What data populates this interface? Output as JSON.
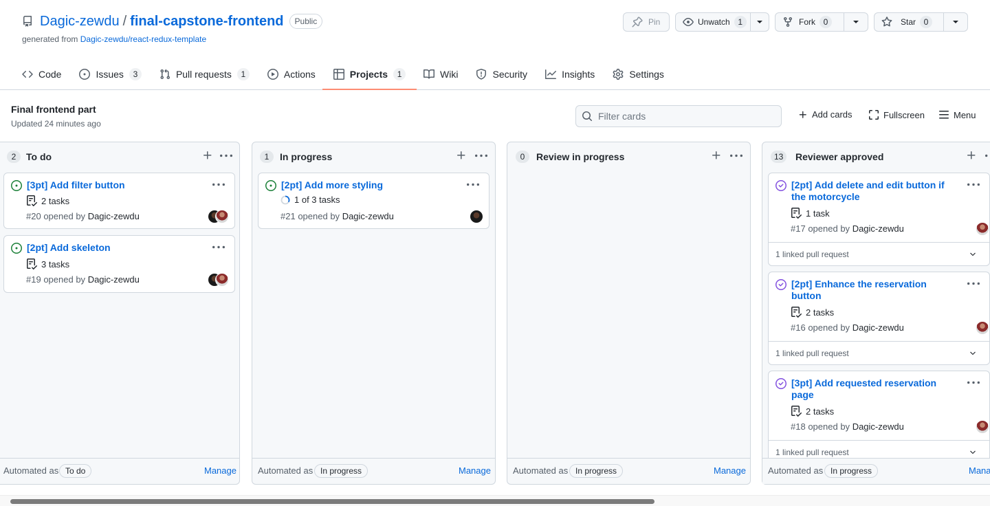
{
  "repo": {
    "owner": "Dagic-zewdu",
    "separator": "/",
    "name": "final-capstone-frontend",
    "visibility": "Public",
    "generated_prefix": "generated from",
    "generated_link": "Dagic-zewdu/react-redux-template"
  },
  "actions": {
    "pin": "Pin",
    "watch": "Unwatch",
    "watch_count": "1",
    "fork": "Fork",
    "fork_count": "0",
    "star": "Star",
    "star_count": "0"
  },
  "nav": {
    "code": "Code",
    "issues": "Issues",
    "issues_count": "3",
    "pulls": "Pull requests",
    "pulls_count": "1",
    "actions": "Actions",
    "projects": "Projects",
    "projects_count": "1",
    "wiki": "Wiki",
    "security": "Security",
    "insights": "Insights",
    "settings": "Settings"
  },
  "project": {
    "name": "Final frontend part",
    "updated": "Updated 24 minutes ago",
    "filter_placeholder": "Filter cards",
    "add_cards": "Add cards",
    "fullscreen": "Fullscreen",
    "menu": "Menu"
  },
  "columns": [
    {
      "count": "2",
      "name": "To do",
      "automated_label": "Automated as",
      "automated_value": "To do",
      "manage": "Manage",
      "cards": [
        {
          "title": "[3pt] Add filter button",
          "tasks": "2 tasks",
          "number": "#20",
          "opened_by": "opened by",
          "author": "Dagic-zewdu"
        },
        {
          "title": "[2pt] Add skeleton",
          "tasks": "3 tasks",
          "number": "#19",
          "opened_by": "opened by",
          "author": "Dagic-zewdu"
        }
      ]
    },
    {
      "count": "1",
      "name": "In progress",
      "automated_label": "Automated as",
      "automated_value": "In progress",
      "manage": "Manage",
      "cards": [
        {
          "title": "[2pt] Add more styling",
          "tasks": "1 of 3 tasks",
          "number": "#21",
          "opened_by": "opened by",
          "author": "Dagic-zewdu"
        }
      ]
    },
    {
      "count": "0",
      "name": "Review in progress",
      "automated_label": "Automated as",
      "automated_value": "In progress",
      "manage": "Manage",
      "cards": []
    },
    {
      "count": "13",
      "name": "Reviewer approved",
      "automated_label": "Automated as",
      "automated_value": "In progress",
      "manage": "Mana",
      "cards": [
        {
          "title": "[2pt] Add delete and edit button if the motorcycle",
          "tasks": "1 task",
          "number": "#17",
          "opened_by": "opened by",
          "author": "Dagic-zewdu",
          "linked": "1 linked pull request"
        },
        {
          "title": "[2pt] Enhance the reservation button",
          "tasks": "2 tasks",
          "number": "#16",
          "opened_by": "opened by",
          "author": "Dagic-zewdu",
          "linked": "1 linked pull request"
        },
        {
          "title": "[3pt] Add requested reservation page",
          "tasks": "2 tasks",
          "number": "#18",
          "opened_by": "opened by",
          "author": "Dagic-zewdu",
          "linked": "1 linked pull request"
        }
      ]
    }
  ],
  "colors": {
    "link": "#0969da",
    "open_issue": "#1a7f37",
    "closed_issue": "#8250df",
    "tab_underline": "#fd8c73"
  }
}
